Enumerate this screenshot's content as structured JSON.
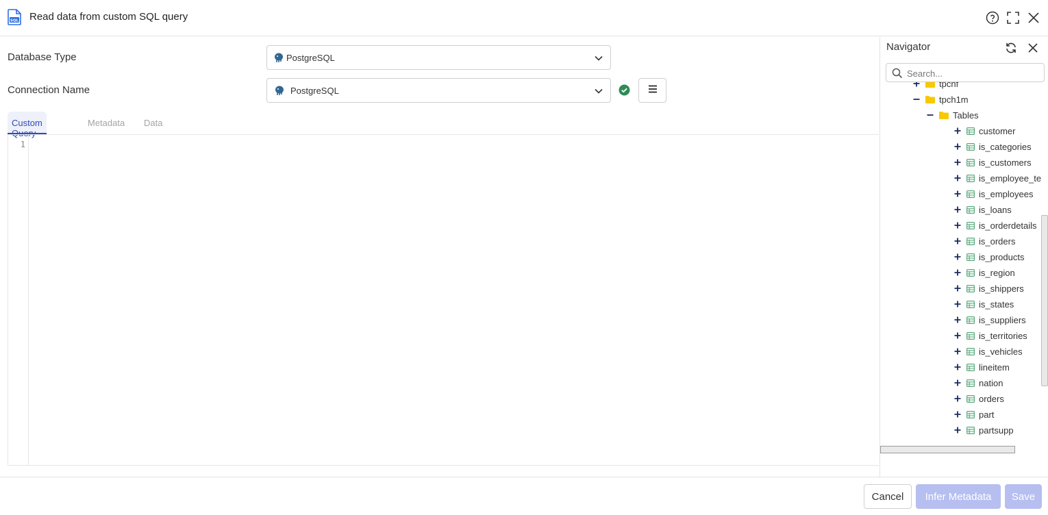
{
  "header": {
    "title": "Read data from custom SQL query"
  },
  "form": {
    "database_type_label": "Database Type",
    "database_type_value": "PostgreSQL",
    "connection_name_label": "Connection Name",
    "connection_name_value": "PostgreSQL"
  },
  "tabs": [
    {
      "label": "Custom Query",
      "active": true
    },
    {
      "label": "Metadata",
      "active": false
    },
    {
      "label": "Data",
      "active": false
    }
  ],
  "editor": {
    "line_numbers": [
      "1"
    ]
  },
  "navigator": {
    "title": "Navigator",
    "search_placeholder": "Search...",
    "tree": [
      {
        "label": "tpchf",
        "type": "folder",
        "toggle": "+"
      },
      {
        "label": "tpch1m",
        "type": "folder",
        "toggle": "−"
      },
      {
        "label": "Tables",
        "type": "folder",
        "toggle": "−"
      },
      {
        "label": "customer",
        "type": "table",
        "toggle": "+"
      },
      {
        "label": "is_categories",
        "type": "table",
        "toggle": "+"
      },
      {
        "label": "is_customers",
        "type": "table",
        "toggle": "+"
      },
      {
        "label": "is_employee_te",
        "type": "table",
        "toggle": "+"
      },
      {
        "label": "is_employees",
        "type": "table",
        "toggle": "+"
      },
      {
        "label": "is_loans",
        "type": "table",
        "toggle": "+"
      },
      {
        "label": "is_orderdetails",
        "type": "table",
        "toggle": "+"
      },
      {
        "label": "is_orders",
        "type": "table",
        "toggle": "+"
      },
      {
        "label": "is_products",
        "type": "table",
        "toggle": "+"
      },
      {
        "label": "is_region",
        "type": "table",
        "toggle": "+"
      },
      {
        "label": "is_shippers",
        "type": "table",
        "toggle": "+"
      },
      {
        "label": "is_states",
        "type": "table",
        "toggle": "+"
      },
      {
        "label": "is_suppliers",
        "type": "table",
        "toggle": "+"
      },
      {
        "label": "is_territories",
        "type": "table",
        "toggle": "+"
      },
      {
        "label": "is_vehicles",
        "type": "table",
        "toggle": "+"
      },
      {
        "label": "lineitem",
        "type": "table",
        "toggle": "+"
      },
      {
        "label": "nation",
        "type": "table",
        "toggle": "+"
      },
      {
        "label": "orders",
        "type": "table",
        "toggle": "+"
      },
      {
        "label": "part",
        "type": "table",
        "toggle": "+"
      },
      {
        "label": "partsupp",
        "type": "table",
        "toggle": "+"
      }
    ]
  },
  "footer": {
    "cancel_label": "Cancel",
    "infer_label": "Infer Metadata",
    "save_label": "Save"
  },
  "colors": {
    "accent": "#2f4bb8",
    "disabled_button": "#b6bff0",
    "success": "#2e8b57",
    "folder": "#f7c900",
    "table_icon": "#5aa87c"
  },
  "icons": [
    "sql-file-icon",
    "help-icon",
    "expand-icon",
    "close-icon",
    "postgresql-icon",
    "chevron-down-icon",
    "check-circle-icon",
    "hamburger-menu-icon",
    "refresh-icon",
    "search-icon",
    "folder-icon",
    "table-icon"
  ]
}
